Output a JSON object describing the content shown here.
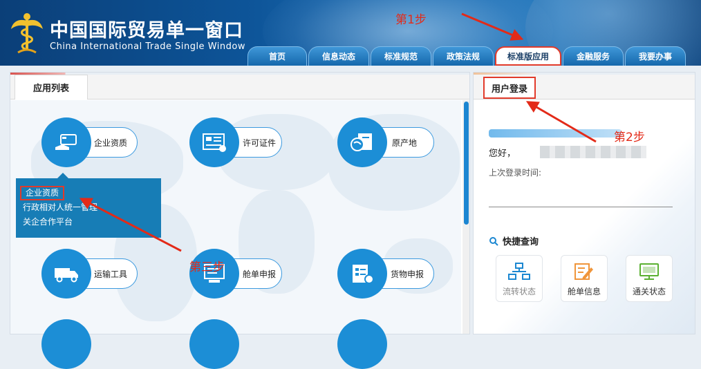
{
  "header": {
    "title_cn": "中国国际贸易单一窗口",
    "title_en": "China International Trade Single Window",
    "nav_tabs": [
      "首页",
      "信息动态",
      "标准规范",
      "政策法规",
      "标准版应用",
      "金融服务",
      "我要办事"
    ],
    "active_tab": "标准版应用"
  },
  "annotations": {
    "step1": "第1步",
    "step2": "第2步",
    "step3": "第三步"
  },
  "left_panel": {
    "tab_label": "应用列表",
    "apps": [
      "企业资质",
      "许可证件",
      "原产地",
      "运输工具",
      "舱单申报",
      "货物申报"
    ],
    "dropdown_items": [
      "企业资质",
      "行政相对人统一管理",
      "关企合作平台"
    ],
    "dropdown_highlighted": "企业资质"
  },
  "right_panel": {
    "tab_label": "用户登录",
    "greeting": "您好，",
    "last_login_label": "上次登录时间:",
    "quick_title": "快捷查询",
    "quick_buttons": [
      {
        "label": "流转状态",
        "color": "#1b87d1"
      },
      {
        "label": "舱单信息",
        "color": "#f0953a"
      },
      {
        "label": "通关状态",
        "color": "#5ab031"
      }
    ]
  },
  "colors": {
    "brand_blue": "#1c8ed6",
    "annotation_red": "#e32a18"
  }
}
